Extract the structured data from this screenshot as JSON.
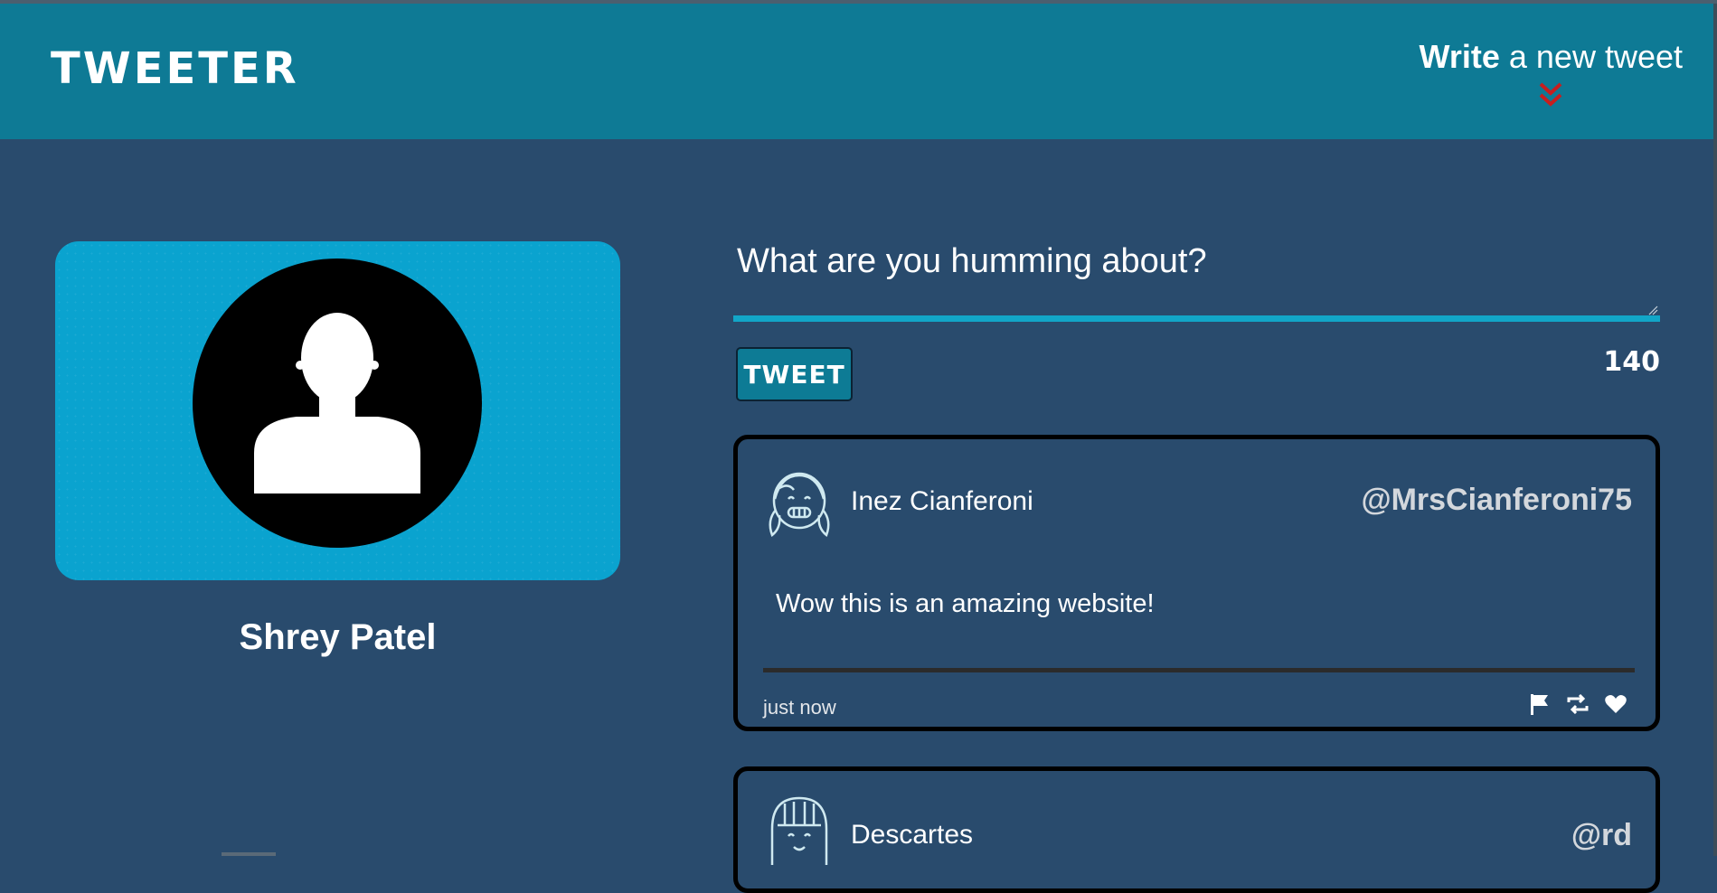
{
  "nav": {
    "brand": "TWEETER",
    "compose_bold": "Write",
    "compose_rest": " a new tweet",
    "chevron_color": "#c81e1e"
  },
  "profile": {
    "name": "Shrey Patel"
  },
  "composer": {
    "placeholder": "What are you humming about?",
    "button_label": "TWEET",
    "char_count": "140"
  },
  "tweets": [
    {
      "name": "Inez Cianferoni",
      "handle": "@MrsCianferoni75",
      "text": "Wow this is an amazing website!",
      "time": "just now",
      "avatar_icon": "girl-pigtails-icon"
    },
    {
      "name": "Descartes",
      "handle": "@rd",
      "avatar_icon": "girl-bangs-icon"
    }
  ],
  "colors": {
    "page_bg": "#294b6d",
    "navbar_bg": "#0e7a95",
    "profile_card_bg": "#0aa3cf",
    "accent_line": "#12a6c8"
  }
}
